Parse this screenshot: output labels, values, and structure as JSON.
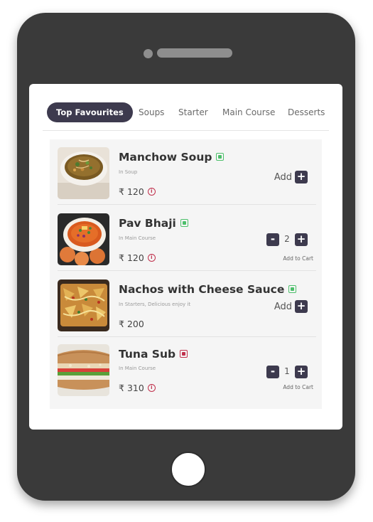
{
  "tabs": [
    {
      "label": "Top Favourites",
      "active": true
    },
    {
      "label": "Soups",
      "active": false
    },
    {
      "label": "Starter",
      "active": false
    },
    {
      "label": "Main Course",
      "active": false
    },
    {
      "label": "Desserts",
      "active": false
    }
  ],
  "items": [
    {
      "name": "Manchow Soup",
      "veg": true,
      "category": "In Soup",
      "currency": "₹",
      "price": "120",
      "has_info": true,
      "add_label": "Add",
      "plus_symbol": "+"
    },
    {
      "name": "Pav Bhaji",
      "veg": true,
      "category": "In Main Course",
      "currency": "₹",
      "price": "120",
      "has_info": true,
      "quantity": "2",
      "minus_symbol": "-",
      "plus_symbol": "+",
      "add_to_cart": "Add to Cart"
    },
    {
      "name": "Nachos with Cheese Sauce",
      "veg": true,
      "category": "In Starters, Delicious enjoy it",
      "currency": "₹",
      "price": "200",
      "has_info": false,
      "add_label": "Add",
      "plus_symbol": "+"
    },
    {
      "name": "Tuna Sub",
      "veg": false,
      "category": "In Main Course",
      "currency": "₹",
      "price": "310",
      "has_info": true,
      "quantity": "1",
      "minus_symbol": "-",
      "plus_symbol": "+",
      "add_to_cart": "Add to Cart"
    }
  ],
  "icons": {
    "info": "i"
  },
  "colors": {
    "accent": "#3d3a4e",
    "veg": "#4cbf6a",
    "nonveg": "#c0304c",
    "device": "#3a3a3a"
  }
}
